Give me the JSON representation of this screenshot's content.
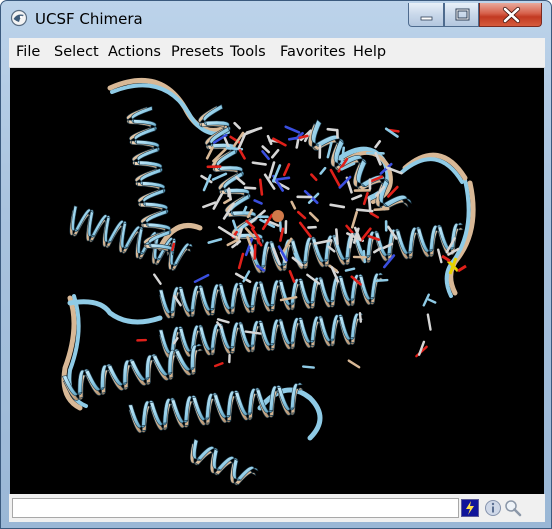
{
  "window": {
    "title": "UCSF Chimera",
    "controls": [
      "minimize",
      "maximize",
      "close"
    ]
  },
  "menubar": {
    "items": [
      "File",
      "Select",
      "Actions",
      "Presets",
      "Tools",
      "Favorites",
      "Help"
    ]
  },
  "viewer": {
    "background_color": "#000000",
    "content": "protein-ribbon-superposition",
    "ribbon_colors": [
      "#8fcbe6",
      "#d8b896"
    ],
    "atom_colors": {
      "carbon": "#d6d6d6",
      "oxygen": "#e0201a",
      "nitrogen": "#3a4fe0",
      "sulfur": "#e8d200",
      "metal": "#d07a4a"
    }
  },
  "statusbar": {
    "message": "",
    "icons": [
      "command-line-icon",
      "info-icon",
      "zoom-icon"
    ]
  }
}
